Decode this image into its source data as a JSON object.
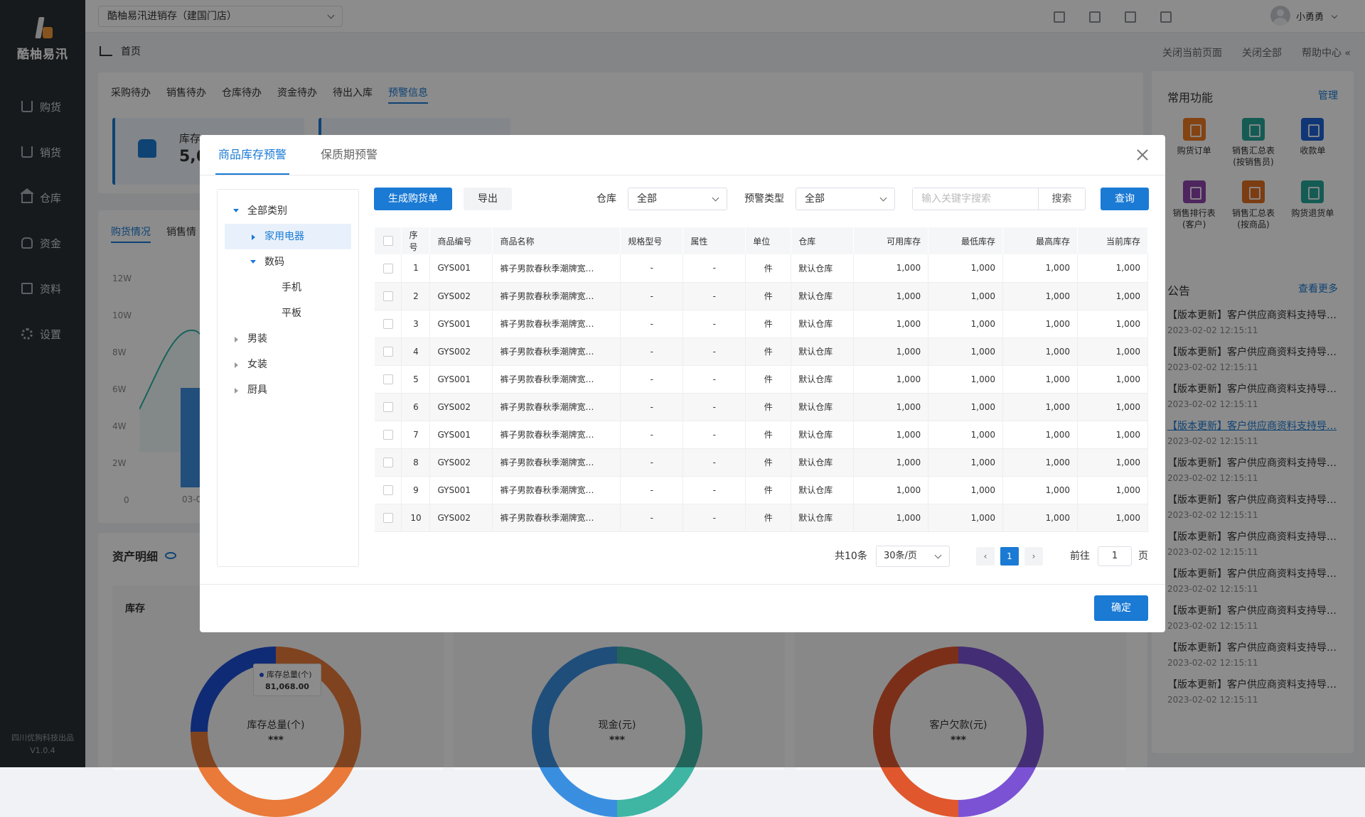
{
  "app": {
    "name": "酷柚易汛",
    "footer_company": "四川优狗科技出品",
    "version": "V1.0.4"
  },
  "sidebar": {
    "items": [
      {
        "label": "购货",
        "icon": "cart-icon"
      },
      {
        "label": "销货",
        "icon": "basket-icon"
      },
      {
        "label": "仓库",
        "icon": "warehouse-icon"
      },
      {
        "label": "资金",
        "icon": "money-bag-icon"
      },
      {
        "label": "资料",
        "icon": "truck-icon"
      },
      {
        "label": "设置",
        "icon": "gear-icon"
      }
    ]
  },
  "topbar": {
    "store": "酷柚易汛进销存（建国门店）",
    "user": "小勇勇",
    "icons": [
      "scan-icon",
      "monitor-icon",
      "shop-icon",
      "download-icon"
    ]
  },
  "subbar": {
    "page_title": "首页",
    "actions": [
      "关闭当前页面",
      "关闭全部",
      "帮助中心 «"
    ]
  },
  "main": {
    "tabs": [
      "采购待办",
      "销售待办",
      "仓库待办",
      "资金待办",
      "待出入库",
      "预警信息"
    ],
    "active_tab": "预警信息",
    "card_label": "库存",
    "card_value": "5,6",
    "chart_tabs": [
      "购货情况",
      "销售情"
    ],
    "y_ticks": [
      "12W",
      "10W",
      "8W",
      "6W",
      "4W",
      "2W",
      "0"
    ],
    "x_tick": "03-0",
    "asset_title": "资产明细",
    "asset_card_title": "库存",
    "donuts": [
      {
        "label": "库存总量(个)",
        "value": "***",
        "tooltip_label": "库存总量(个)",
        "tooltip_value": "81,068.00"
      },
      {
        "label": "现金(元)",
        "value": "***"
      },
      {
        "label": "客户欠款(元)",
        "value": "***"
      }
    ]
  },
  "right_panel": {
    "common_title": "常用功能",
    "manage": "管理",
    "functions": [
      {
        "label": "购货订单",
        "color": "#f07a22"
      },
      {
        "label": "销售汇总表\n(按销售员)",
        "color": "#26a69a"
      },
      {
        "label": "收款单",
        "color": "#1e63d8"
      },
      {
        "label": "销售排行表\n(客户)",
        "color": "#8e44ad"
      },
      {
        "label": "销售汇总表\n(按商品)",
        "color": "#e0701f"
      },
      {
        "label": "购货退货单",
        "color": "#26a69a"
      }
    ],
    "notice_title": "公告",
    "more": "查看更多",
    "notices": [
      {
        "title": "【版本更新】客户供应商资料支持导…",
        "date": "2023-02-02 12:15:11"
      },
      {
        "title": "【版本更新】客户供应商资料支持导…",
        "date": "2023-02-02 12:15:11"
      },
      {
        "title": "【版本更新】客户供应商资料支持导…",
        "date": "2023-02-02 12:15:11"
      },
      {
        "title": "【版本更新】客户供应商资料支持导…",
        "date": "2023-02-02 12:15:11"
      },
      {
        "title": "【版本更新】客户供应商资料支持导…",
        "date": "2023-02-02 12:15:11"
      },
      {
        "title": "【版本更新】客户供应商资料支持导…",
        "date": "2023-02-02 12:15:11"
      },
      {
        "title": "【版本更新】客户供应商资料支持导…",
        "date": "2023-02-02 12:15:11"
      },
      {
        "title": "【版本更新】客户供应商资料支持导…",
        "date": "2023-02-02 12:15:11"
      },
      {
        "title": "【版本更新】客户供应商资料支持导…",
        "date": "2023-02-02 12:15:11"
      },
      {
        "title": "【版本更新】客户供应商资料支持导…",
        "date": "2023-02-02 12:15:11"
      },
      {
        "title": "【版本更新】客户供应商资料支持导…",
        "date": "2023-02-02 12:15:11"
      }
    ]
  },
  "dialog": {
    "tabs": [
      "商品库存预警",
      "保质期预警"
    ],
    "active_tab": "商品库存预警",
    "tree": [
      {
        "label": "全部类别",
        "level": 0,
        "expanded": true
      },
      {
        "label": "家用电器",
        "level": 1,
        "expanded": false,
        "selected": true
      },
      {
        "label": "数码",
        "level": 1,
        "expanded": true
      },
      {
        "label": "手机",
        "level": 2
      },
      {
        "label": "平板",
        "level": 2
      },
      {
        "label": "男装",
        "level": 0,
        "expanded": false
      },
      {
        "label": "女装",
        "level": 0,
        "expanded": false
      },
      {
        "label": "厨具",
        "level": 0,
        "expanded": false
      }
    ],
    "toolbar": {
      "generate": "生成购货单",
      "export": "导出",
      "warehouse_label": "仓库",
      "warehouse_value": "全部",
      "alert_type_label": "预警类型",
      "alert_type_value": "全部",
      "search_placeholder": "输入关键字搜索",
      "search": "搜索",
      "query": "查询"
    },
    "table": {
      "columns": [
        "序号",
        "商品编号",
        "商品名称",
        "规格型号",
        "属性",
        "单位",
        "仓库",
        "可用库存",
        "最低库存",
        "最高库存",
        "当前库存"
      ],
      "rows": [
        [
          "1",
          "GYS001",
          "裤子男款春秋季潮牌宽…",
          "-",
          "-",
          "件",
          "默认仓库",
          "1,000",
          "1,000",
          "1,000",
          "1,000"
        ],
        [
          "2",
          "GYS002",
          "裤子男款春秋季潮牌宽…",
          "-",
          "-",
          "件",
          "默认仓库",
          "1,000",
          "1,000",
          "1,000",
          "1,000"
        ],
        [
          "3",
          "GYS001",
          "裤子男款春秋季潮牌宽…",
          "-",
          "-",
          "件",
          "默认仓库",
          "1,000",
          "1,000",
          "1,000",
          "1,000"
        ],
        [
          "4",
          "GYS002",
          "裤子男款春秋季潮牌宽…",
          "-",
          "-",
          "件",
          "默认仓库",
          "1,000",
          "1,000",
          "1,000",
          "1,000"
        ],
        [
          "5",
          "GYS001",
          "裤子男款春秋季潮牌宽…",
          "-",
          "-",
          "件",
          "默认仓库",
          "1,000",
          "1,000",
          "1,000",
          "1,000"
        ],
        [
          "6",
          "GYS002",
          "裤子男款春秋季潮牌宽…",
          "-",
          "-",
          "件",
          "默认仓库",
          "1,000",
          "1,000",
          "1,000",
          "1,000"
        ],
        [
          "7",
          "GYS001",
          "裤子男款春秋季潮牌宽…",
          "-",
          "-",
          "件",
          "默认仓库",
          "1,000",
          "1,000",
          "1,000",
          "1,000"
        ],
        [
          "8",
          "GYS002",
          "裤子男款春秋季潮牌宽…",
          "-",
          "-",
          "件",
          "默认仓库",
          "1,000",
          "1,000",
          "1,000",
          "1,000"
        ],
        [
          "9",
          "GYS001",
          "裤子男款春秋季潮牌宽…",
          "-",
          "-",
          "件",
          "默认仓库",
          "1,000",
          "1,000",
          "1,000",
          "1,000"
        ],
        [
          "10",
          "GYS002",
          "裤子男款春秋季潮牌宽…",
          "-",
          "-",
          "件",
          "默认仓库",
          "1,000",
          "1,000",
          "1,000",
          "1,000"
        ]
      ]
    },
    "pager": {
      "total": "共10条",
      "page_size": "30条/页",
      "current": "1",
      "goto_label": "前往",
      "goto_value": "1",
      "page_unit": "页"
    },
    "confirm": "确定"
  },
  "colors": {
    "accent": "#1a7ad4",
    "sidebar_bg": "#2b3035"
  }
}
